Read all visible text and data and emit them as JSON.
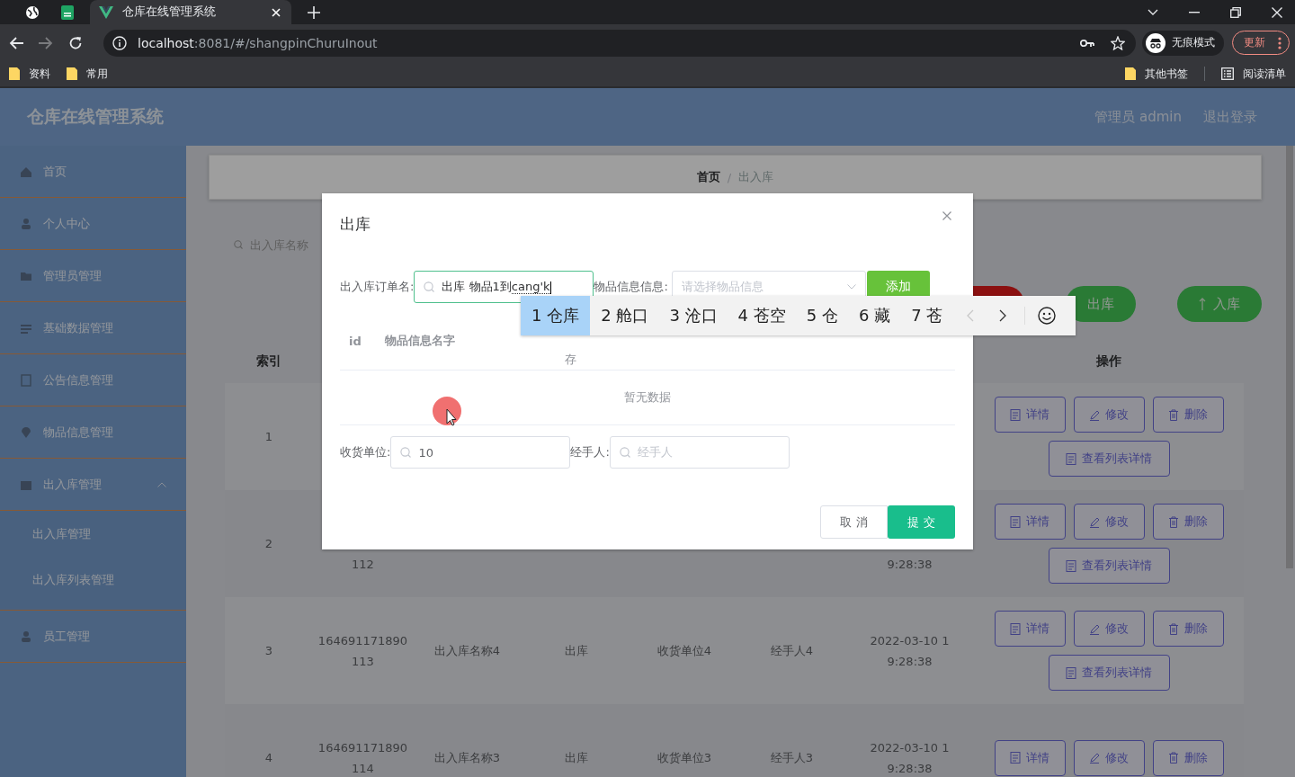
{
  "browser": {
    "tabs": [
      {
        "kind": "globe",
        "selected": false
      },
      {
        "kind": "sheet",
        "selected": false
      },
      {
        "kind": "page",
        "title": "仓库在线管理系统",
        "selected": true
      }
    ],
    "url": {
      "host": "localhost",
      "path": ":8081/#/shangpinChuruInout"
    },
    "forward_disabled": true,
    "profile": "无痕模式",
    "update_button": "更新",
    "bookmarks": [
      {
        "kind": "folder",
        "label": "资料"
      },
      {
        "kind": "folder",
        "label": "常用"
      }
    ],
    "bookmarks_right": [
      {
        "kind": "folder",
        "label": "其他书签"
      },
      {
        "kind": "reading-list",
        "label": "阅读清单"
      }
    ]
  },
  "app": {
    "title": "仓库在线管理系统",
    "user": "管理员 admin",
    "logout": "退出登录"
  },
  "sidebar": {
    "items": [
      {
        "label": "首页"
      },
      {
        "label": "个人中心"
      },
      {
        "label": "管理员管理"
      },
      {
        "label": "基础数据管理"
      },
      {
        "label": "公告信息管理"
      },
      {
        "label": "物品信息管理"
      },
      {
        "label": "出入库管理",
        "expanded": true,
        "children": [
          {
            "label": "出入库管理"
          },
          {
            "label": "出入库列表管理"
          }
        ]
      },
      {
        "label": "员工管理"
      }
    ]
  },
  "breadcrumb": {
    "items": [
      "首页",
      "出入库"
    ],
    "separator": "/"
  },
  "search": {
    "placeholder": "出入库名称"
  },
  "actions": [
    {
      "kind": "danger"
    },
    {
      "kind": "success",
      "label": "出库"
    },
    {
      "kind": "success",
      "label": "入库"
    }
  ],
  "table": {
    "index_header": "索引",
    "actions_header": "操作",
    "rows": [
      {
        "index": "1",
        "buttons": [
          "详情",
          "修改",
          "删除",
          "查看列表详情"
        ]
      },
      {
        "index": "2",
        "id": "112",
        "time": "9:28:38",
        "buttons": [
          "详情",
          "修改",
          "删除",
          "查看列表详情"
        ]
      },
      {
        "index": "3",
        "id": "164691171890113",
        "name": "出入库名称4",
        "type": "出库",
        "unit": "收货单位4",
        "handler": "经手人4",
        "time": "2022-03-10 19:28:38",
        "buttons": [
          "详情",
          "修改",
          "删除",
          "查看列表详情"
        ]
      },
      {
        "index": "4",
        "id": "164691171890114",
        "name": "出入库名称3",
        "type": "出库",
        "unit": "收货单位3",
        "handler": "经手人3",
        "time": "2022-03-10 19:28:38",
        "buttons": [
          "详情",
          "修改",
          "删除"
        ]
      }
    ]
  },
  "dialog": {
    "title": "出库",
    "order_name": {
      "label": "出入库订单名:",
      "value": "出库 物品1到",
      "composing": "cang'k"
    },
    "item_select": {
      "label": "物品信息信息:",
      "placeholder": "请选择物品信息"
    },
    "add_button": "添加",
    "columns": [
      "id",
      "物品信息名字",
      "存"
    ],
    "empty_text": "暂无数据",
    "unit": {
      "label": "收货单位:",
      "value": "10"
    },
    "handler": {
      "label": "经手人:",
      "placeholder": "经手人"
    },
    "cancel": "取 消",
    "submit": "提 交"
  },
  "ime": {
    "candidates": [
      {
        "label": "1 仓库",
        "selected": true
      },
      {
        "label": "2 舱口",
        "selected": false
      },
      {
        "label": "3 沧口",
        "selected": false
      },
      {
        "label": "4 苍空",
        "selected": false
      },
      {
        "label": "5 仓",
        "selected": false
      },
      {
        "label": "6 藏",
        "selected": false
      },
      {
        "label": "7 苍",
        "selected": false
      }
    ],
    "prev_disabled": true
  }
}
